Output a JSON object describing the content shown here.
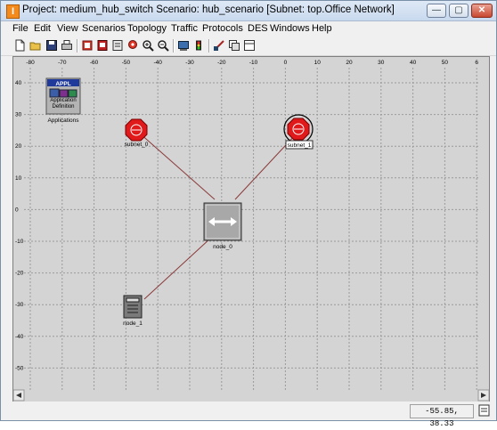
{
  "window": {
    "app_icon_letter": "I",
    "title": "Project: medium_hub_switch Scenario: hub_scenario  [Subnet: top.Office Network]",
    "minimize": "—",
    "maximize": "▢",
    "close": "✕"
  },
  "menu": [
    "File",
    "Edit",
    "View",
    "Scenarios",
    "Topology",
    "Traffic",
    "Protocols",
    "DES",
    "Windows",
    "Help"
  ],
  "toolbar": {
    "icons": [
      "new-project-icon",
      "open-icon",
      "save-icon",
      "print-icon",
      "delete-icon",
      "scenario-icon",
      "failure-icon",
      "zoom-in-icon",
      "zoom-out-icon",
      "configure-sim-icon",
      "run-sim-icon",
      "results-icon",
      "hide-graphs-icon"
    ]
  },
  "canvas": {
    "x_ticks": [
      "-80",
      "-70",
      "-60",
      "-50",
      "-40",
      "-30",
      "-20",
      "-10",
      "0",
      "10",
      "20",
      "30",
      "40",
      "50",
      "6"
    ],
    "y_ticks": [
      "40",
      "30",
      "20",
      "10",
      "0",
      "-10",
      "-20",
      "-30",
      "-40",
      "-50"
    ],
    "nodes": {
      "app_def": {
        "badge": "APPL",
        "inner_text": "Application Definition",
        "label": "Applications"
      },
      "subnet_0": {
        "label": "subnet_0"
      },
      "subnet_1": {
        "label": "subnet_1"
      },
      "node_0": {
        "label": "node_0"
      },
      "node_1": {
        "label": "node_1"
      }
    },
    "link_color": "#8b3a3a",
    "router_color": "#e0191b"
  },
  "status": {
    "coordinates": "-55.85, 38.33"
  }
}
